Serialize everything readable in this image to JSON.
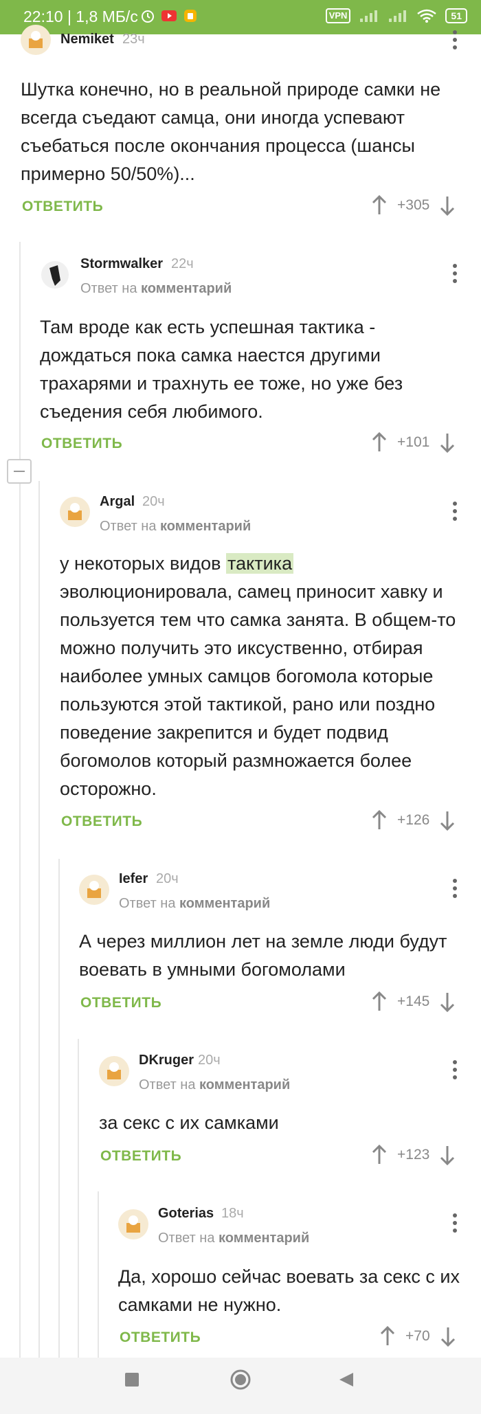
{
  "status_bar": {
    "time": "22:10 | 1,8 МБ/с",
    "vpn": "VPN",
    "battery": "51"
  },
  "colors": {
    "accent": "#7fb84a",
    "highlight": "#d9eac3"
  },
  "comments": [
    {
      "author": "Nemiket",
      "time": "23ч",
      "reply_to": null,
      "text": "Шутка конечно, но в реальной природе самки не всегда съедают самца, они иногда успевают съебаться после окончания процесса (шансы примерно 50/50%)...",
      "reply_label": "ОТВЕТИТЬ",
      "rating": "+305"
    },
    {
      "author": "Stormwalker",
      "time": "22ч",
      "reply_to": {
        "prefix": "Ответ на",
        "target": "комментарий"
      },
      "text": "Там вроде как есть успешная тактика - дождаться пока самка наестся другими трахарями и трахнуть ее тоже, но уже без съедения себя любимого.",
      "reply_label": "ОТВЕТИТЬ",
      "rating": "+101"
    },
    {
      "author": "Argal",
      "time": "20ч",
      "reply_to": {
        "prefix": "Ответ на",
        "target": "комментарий"
      },
      "text_before": "у некоторых видов ",
      "text_highlight": "тактика",
      "text_after": " эволюционировала, самец приносит хавку и пользуется тем что самка занята. В общем-то можно получить это иксуственно, отбирая наиболее умных самцов богомола которые пользуются этой тактикой, рано или поздно поведение закрепится и будет подвид богомолов который размножается более осторожно.",
      "reply_label": "ОТВЕТИТЬ",
      "rating": "+126"
    },
    {
      "author": "Iefer",
      "time": "20ч",
      "reply_to": {
        "prefix": "Ответ на",
        "target": "комментарий"
      },
      "text": "А через миллион лет на земле люди будут воевать в умными богомолами",
      "reply_label": "ОТВЕТИТЬ",
      "rating": "+145"
    },
    {
      "author": "DKruger",
      "time": "20ч",
      "reply_to": {
        "prefix": "Ответ на",
        "target": "комментарий"
      },
      "text": "за секс с их самками",
      "reply_label": "ОТВЕТИТЬ",
      "rating": "+123"
    },
    {
      "author": "Goterias",
      "time": "18ч",
      "reply_to": {
        "prefix": "Ответ на",
        "target": "комментарий"
      },
      "text": "Да, хорошо сейчас воевать за секс с их самками не нужно.",
      "reply_label": "ОТВЕТИТЬ",
      "rating": "+70"
    }
  ],
  "icons": {
    "upvote": "arrow-up-icon",
    "downvote": "arrow-down-icon",
    "menu": "more-vertical-icon",
    "nav": [
      "square-icon",
      "circle-icon",
      "back-triangle-icon"
    ]
  }
}
